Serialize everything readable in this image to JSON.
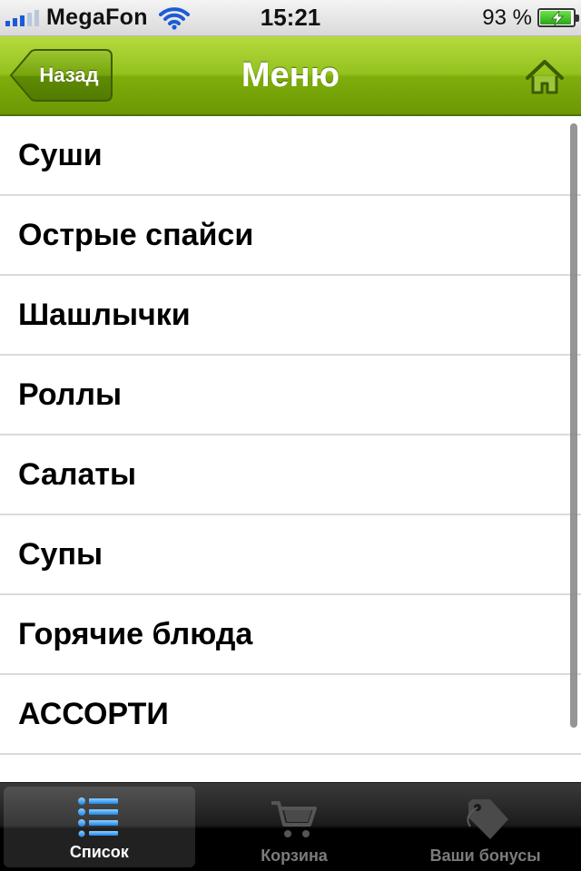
{
  "status_bar": {
    "carrier": "MegaFon",
    "time": "15:21",
    "battery_percent": "93 %"
  },
  "nav": {
    "back_label": "Назад",
    "title": "Меню"
  },
  "menu": {
    "items": [
      {
        "label": "Суши"
      },
      {
        "label": "Острые спайси"
      },
      {
        "label": "Шашлычки"
      },
      {
        "label": "Роллы"
      },
      {
        "label": "Салаты"
      },
      {
        "label": "Супы"
      },
      {
        "label": "Горячие блюда"
      },
      {
        "label": "АССОРТИ"
      }
    ]
  },
  "tabs": [
    {
      "label": "Список",
      "icon": "list-icon",
      "active": true
    },
    {
      "label": "Корзина",
      "icon": "cart-icon",
      "active": false
    },
    {
      "label": "Ваши бонусы",
      "icon": "tag-icon",
      "active": false
    }
  ],
  "colors": {
    "nav_green": "#8cbb17",
    "tab_active_icon": "#2f9cf4"
  }
}
